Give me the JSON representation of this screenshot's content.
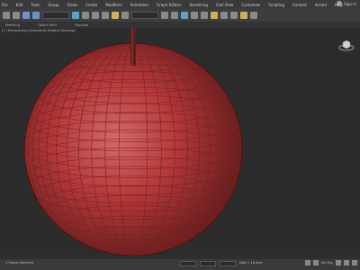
{
  "menu": {
    "items": [
      "File",
      "Edit",
      "Tools",
      "Group",
      "Views",
      "Create",
      "Modifiers",
      "Animation",
      "Graph Editors",
      "Rendering",
      "Civil View",
      "Customize",
      "Scripting",
      "Content",
      "Arnold",
      "Help"
    ],
    "signin": "Sign In"
  },
  "ribbon": {
    "items": [
      "Modeling",
      "Object Paint",
      "Populate"
    ]
  },
  "viewport": {
    "label": "[+] [Perspective] [Standard] [Default Shading]"
  },
  "status": {
    "text": "1 Object Selected",
    "autokey": "Set Key",
    "zoom": "Grid = 10.0cm"
  },
  "colors": {
    "apple_base": "#b5393a",
    "apple_highlight": "#d46a6a",
    "apple_shadow": "#5e1a1a",
    "wire": "#7a2324"
  },
  "icons": [
    "undo-icon",
    "redo-icon",
    "link-icon",
    "unlink-icon",
    "select-icon",
    "move-icon",
    "rotate-icon",
    "scale-icon",
    "snap-icon",
    "render-icon",
    "teapot-icon"
  ]
}
